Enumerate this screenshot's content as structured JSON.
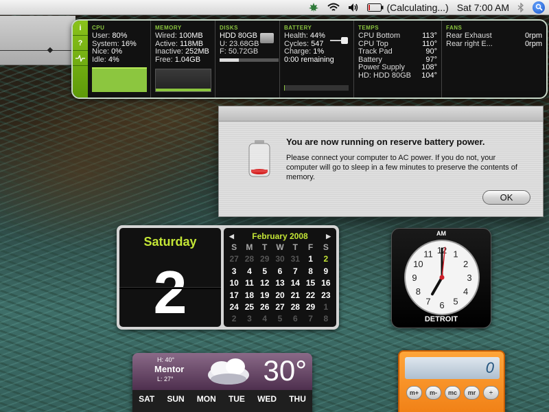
{
  "menubar": {
    "battery_status": "(Calculating...)",
    "clock": "Sat 7:00 AM"
  },
  "istat": {
    "tabs": [
      "i",
      "?",
      ""
    ],
    "cpu": {
      "header": "CPU",
      "rows": [
        {
          "label": "User:",
          "value": "80%"
        },
        {
          "label": "System:",
          "value": "16%"
        },
        {
          "label": "Nice:",
          "value": "0%"
        },
        {
          "label": "Idle:",
          "value": "4%"
        }
      ]
    },
    "memory": {
      "header": "MEMORY",
      "rows": [
        {
          "label": "Wired:",
          "value": "100MB"
        },
        {
          "label": "Active:",
          "value": "118MB"
        },
        {
          "label": "Inactive:",
          "value": "252MB"
        },
        {
          "label": "Free:",
          "value": "1.04GB"
        }
      ]
    },
    "disks": {
      "header": "DISKS",
      "name": "HDD 80GB",
      "used": "U: 23.68GB",
      "free": "F: 50.72GB",
      "used_fraction": 0.32
    },
    "battery": {
      "header": "BATTERY",
      "rows": [
        {
          "label": "Health:",
          "value": "44%"
        },
        {
          "label": "Cycles:",
          "value": "547"
        },
        {
          "label": "Charge:",
          "value": "1%"
        }
      ],
      "remaining": "0:00 remaining",
      "charge_fraction": 0.01
    },
    "temps": {
      "header": "TEMPS",
      "rows": [
        {
          "label": "CPU Bottom",
          "value": "113°"
        },
        {
          "label": "CPU Top",
          "value": "110°"
        },
        {
          "label": "Track Pad",
          "value": "90°"
        },
        {
          "label": "Battery",
          "value": "97°"
        },
        {
          "label": "Power Supply",
          "value": "108°"
        },
        {
          "label": "HD: HDD 80GB",
          "value": "104°"
        }
      ]
    },
    "fans": {
      "header": "FANS",
      "rows": [
        {
          "label": "Rear Exhaust",
          "value": "0rpm"
        },
        {
          "label": "Rear right E...",
          "value": "0rpm"
        }
      ]
    }
  },
  "alert": {
    "title": "You are now running on reserve battery power.",
    "message": "Please connect your computer to AC power. If you do not, your computer will go to sleep in a few minutes to preserve the contents of memory.",
    "ok_label": "OK"
  },
  "calendar": {
    "day_name": "Saturday",
    "date_number": "2",
    "month_title": "February 2008",
    "weekdays": [
      "S",
      "M",
      "T",
      "W",
      "T",
      "F",
      "S"
    ],
    "weeks": [
      [
        "27",
        "28",
        "29",
        "30",
        "31",
        "1",
        "2"
      ],
      [
        "3",
        "4",
        "5",
        "6",
        "7",
        "8",
        "9"
      ],
      [
        "10",
        "11",
        "12",
        "13",
        "14",
        "15",
        "16"
      ],
      [
        "17",
        "18",
        "19",
        "20",
        "21",
        "22",
        "23"
      ],
      [
        "24",
        "25",
        "26",
        "27",
        "28",
        "29",
        "1"
      ],
      [
        "2",
        "3",
        "4",
        "5",
        "6",
        "7",
        "8"
      ]
    ]
  },
  "clock": {
    "ampm": "AM",
    "city": "DETROIT",
    "hour": 7,
    "minute": 0,
    "second": 1,
    "numbers": [
      "12",
      "1",
      "2",
      "3",
      "4",
      "5",
      "6",
      "7",
      "8",
      "9",
      "10",
      "11"
    ]
  },
  "weather": {
    "high": "H: 40°",
    "city": "Mentor",
    "low": "L: 27°",
    "temp": "30°",
    "days": [
      "SAT",
      "SUN",
      "MON",
      "TUE",
      "WED",
      "THU"
    ]
  },
  "calculator": {
    "display": "0",
    "keys": [
      "m+",
      "m-",
      "mc",
      "mr",
      "÷"
    ]
  },
  "colors": {
    "istat_accent": "#8cc63f",
    "calendar_accent": "#c4e636",
    "calculator_orange": "#f08a1a",
    "clock_second_hand": "#d0202a"
  }
}
